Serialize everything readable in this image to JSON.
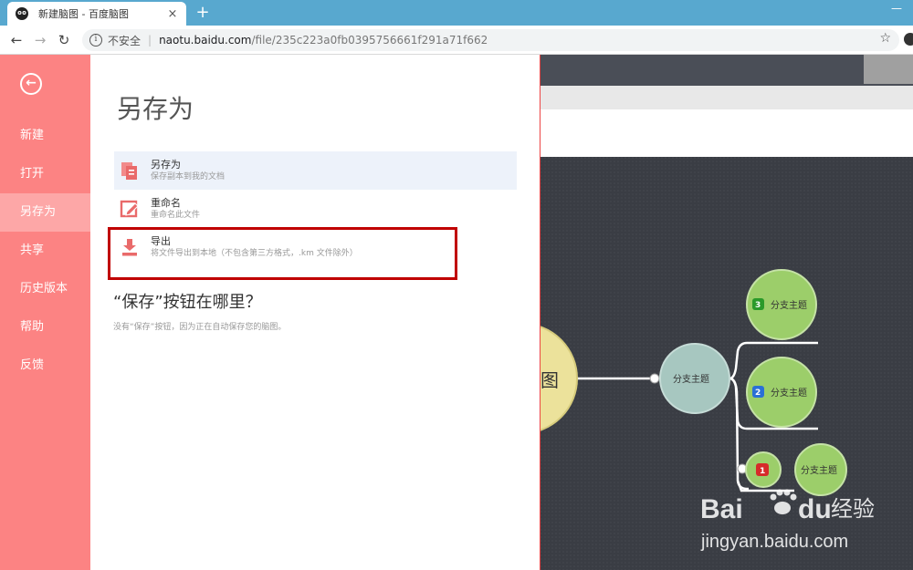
{
  "browser": {
    "tab_title": "新建脑图 - 百度脑图",
    "close_glyph": "×",
    "new_tab_glyph": "+",
    "minimize_glyph": "—",
    "back_glyph": "←",
    "forward_glyph": "→",
    "reload_glyph": "↻",
    "info_glyph": "i",
    "security_label": "不安全",
    "separator": "|",
    "url_host": "naotu.baidu.com",
    "url_path": "/file/235c223a0fb0395756661f291a71f662",
    "star_glyph": "☆"
  },
  "sidebar": {
    "back_glyph": "←",
    "items": [
      {
        "label": "新建"
      },
      {
        "label": "打开"
      },
      {
        "label": "另存为",
        "active": true
      },
      {
        "label": "共享"
      },
      {
        "label": "历史版本"
      },
      {
        "label": "帮助"
      },
      {
        "label": "反馈"
      }
    ]
  },
  "panel": {
    "title": "另存为",
    "options": [
      {
        "name": "另存为",
        "desc": "保存副本到我的文档",
        "icon": "copy-file-icon"
      },
      {
        "name": "重命名",
        "desc": "重命名此文件",
        "icon": "edit-icon"
      },
      {
        "name": "导出",
        "desc": "将文件导出到本地（不包含第三方格式，.km 文件除外）",
        "icon": "download-icon"
      }
    ],
    "faq_title": "“保存”按钮在哪里？",
    "faq_desc": "没有“保存”按钮，因为正在自动保存您的脑图。"
  },
  "mindmap": {
    "root_text": "图",
    "main_branch": "分支主题",
    "sub_branches": [
      {
        "label": "分支主题",
        "priority": "3"
      },
      {
        "label": "分支主题",
        "priority": "2"
      },
      {
        "label": "分支主题",
        "priority": "1"
      },
      {
        "label": "分支主题"
      }
    ]
  },
  "watermark": {
    "brand_bai": "Bai",
    "brand_du": "du",
    "brand_cn": "经验",
    "url": "jingyan.baidu.com"
  },
  "colors": {
    "sidebar": "#fc8383",
    "sidebar_active": "#fda7a7",
    "highlight": "#c00000",
    "map_bg": "#3a3d44",
    "node_green": "#9cce6a",
    "node_teal": "#a7c7c0",
    "root_yellow": "#ece29b"
  }
}
